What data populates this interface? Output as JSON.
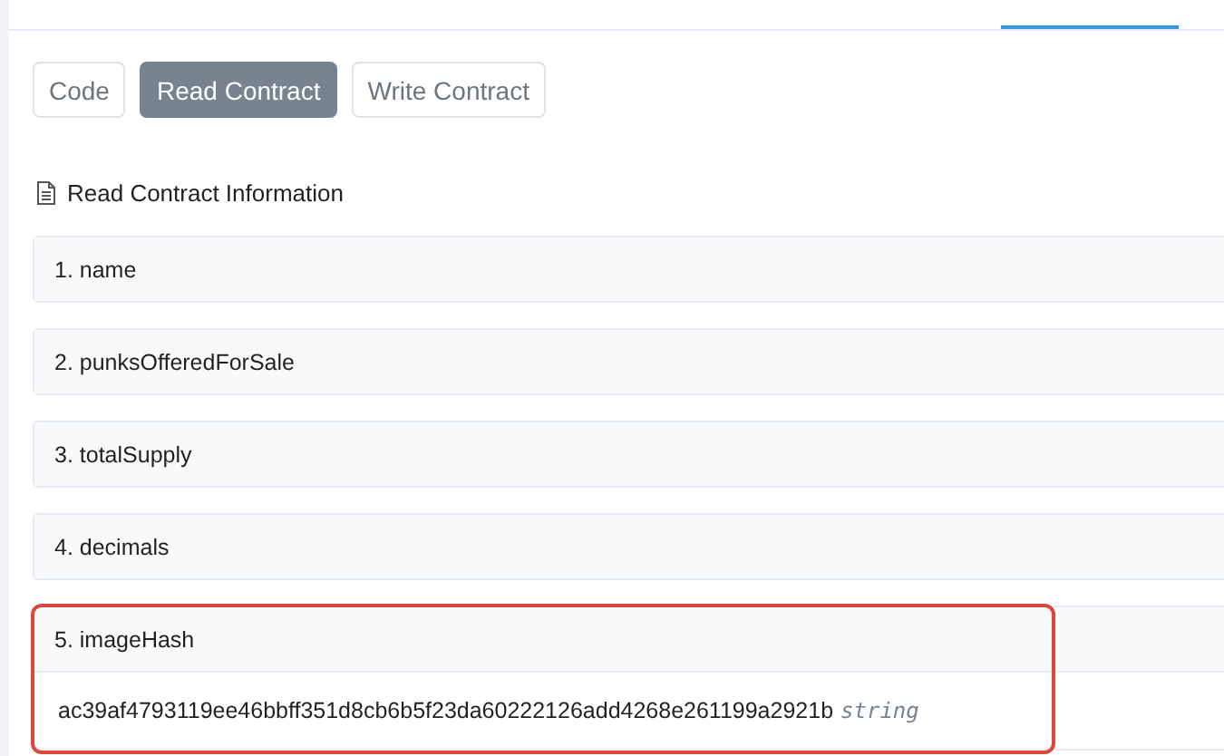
{
  "buttons": [
    {
      "label": "Code",
      "selected": false
    },
    {
      "label": "Read Contract",
      "selected": true
    },
    {
      "label": "Write Contract",
      "selected": false
    }
  ],
  "section_title": "Read Contract Information",
  "items": [
    {
      "label": "1. name",
      "expanded": false,
      "highlighted": false
    },
    {
      "label": "2. punksOfferedForSale",
      "expanded": false,
      "highlighted": false
    },
    {
      "label": "3. totalSupply",
      "expanded": false,
      "highlighted": false
    },
    {
      "label": "4. decimals",
      "expanded": false,
      "highlighted": false
    },
    {
      "label": "5. imageHash",
      "expanded": true,
      "highlighted": true,
      "value": "ac39af4793119ee46bbff351d8cb6b5f23da60222126add4268e261199a2921b",
      "type": "string"
    }
  ]
}
